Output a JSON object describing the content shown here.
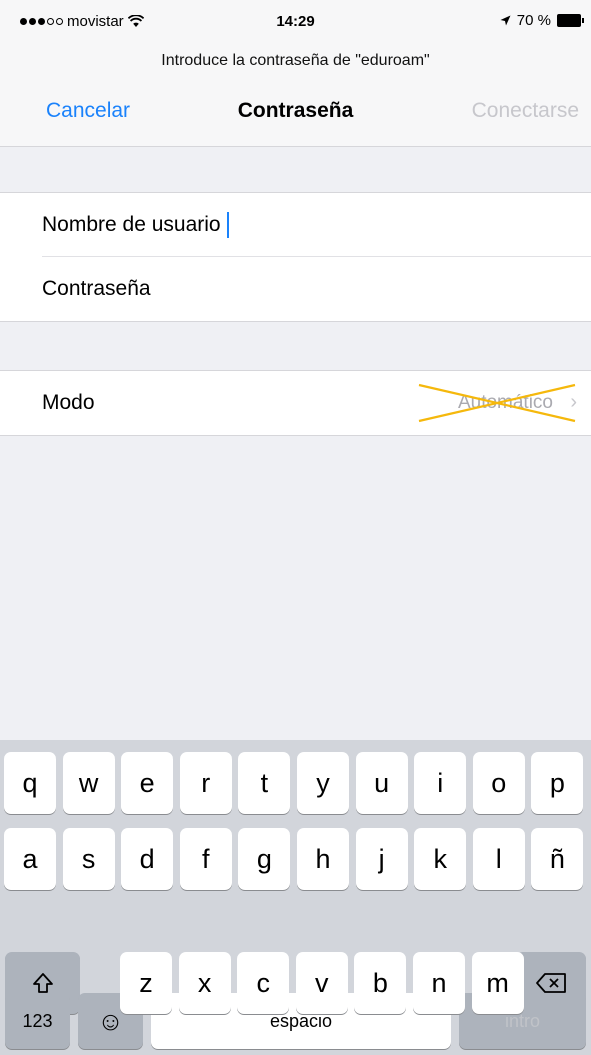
{
  "status_bar": {
    "carrier": "movistar",
    "time": "14:29",
    "battery": "70 %",
    "icons": [
      "signal-dots-icon",
      "wifi-icon",
      "location-arrow-icon",
      "battery-icon"
    ]
  },
  "header": {
    "prompt": "Introduce la contraseña de \"eduroam\"",
    "cancel_label": "Cancelar",
    "title": "Contraseña",
    "connect_label": "Conectarse"
  },
  "form": {
    "username_label": "Nombre de usuario",
    "password_label": "Contraseña"
  },
  "mode": {
    "label": "Modo",
    "value": "Automático",
    "chevron": "›"
  },
  "keyboard": {
    "row1": [
      "q",
      "w",
      "e",
      "r",
      "t",
      "y",
      "u",
      "i",
      "o",
      "p"
    ],
    "row2": [
      "a",
      "s",
      "d",
      "f",
      "g",
      "h",
      "j",
      "k",
      "l",
      "ñ"
    ],
    "row3": [
      "z",
      "x",
      "c",
      "v",
      "b",
      "n",
      "m"
    ],
    "shift": "⇧",
    "numbers_label": "123",
    "emoji": "☺",
    "space_label": "espacio",
    "return_label": "intro"
  },
  "colors": {
    "accent": "#1a82fb",
    "strike": "#f5b80c"
  }
}
